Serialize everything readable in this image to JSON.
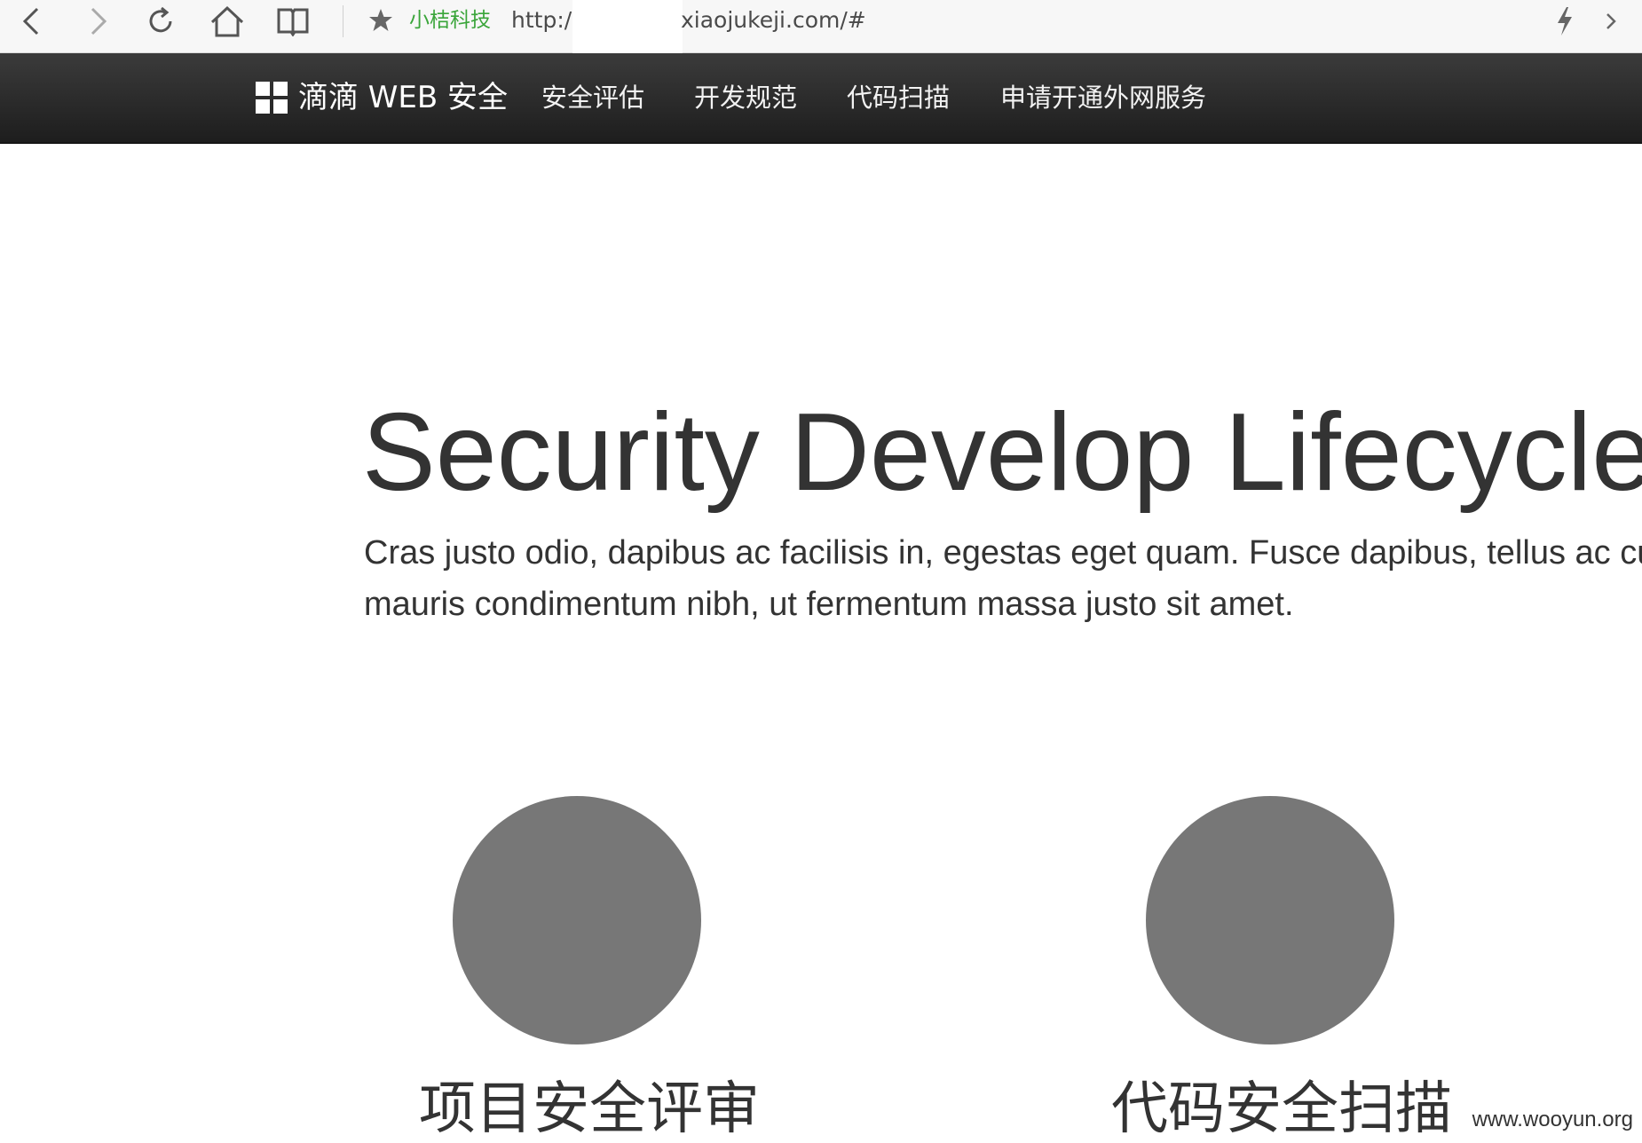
{
  "browser": {
    "site_tag": "小桔科技",
    "url_protocol": "http:/",
    "url_host": "xiaojukeji.com/#",
    "buttons": {
      "back": "back-arrow-icon",
      "forward": "forward-arrow-icon",
      "reload": "reload-icon",
      "home": "home-icon",
      "reader": "book-icon",
      "favorite": "star-icon",
      "boost": "lightning-icon",
      "more": "chevron-right-icon"
    }
  },
  "navbar": {
    "brand": "滴滴 WEB 安全",
    "items": [
      {
        "label": "安全评估"
      },
      {
        "label": "开发规范"
      },
      {
        "label": "代码扫描"
      },
      {
        "label": "申请开通外网服务"
      }
    ]
  },
  "hero": {
    "title": "Security Develop Lifecycle",
    "lead_line1": "Cras justo odio, dapibus ac facilisis in, egestas eget quam. Fusce dapibus, tellus ac cursus commodo, tortor",
    "lead_line2": "mauris condimentum nibh, ut fermentum massa justo sit amet."
  },
  "features": [
    {
      "title": "项目安全评审"
    },
    {
      "title": "代码安全扫描"
    }
  ],
  "watermark": "www.wooyun.org",
  "colors": {
    "navbar_bg": "#222222",
    "circle": "#777777",
    "site_tag": "#3aa53a",
    "text": "#333333"
  }
}
